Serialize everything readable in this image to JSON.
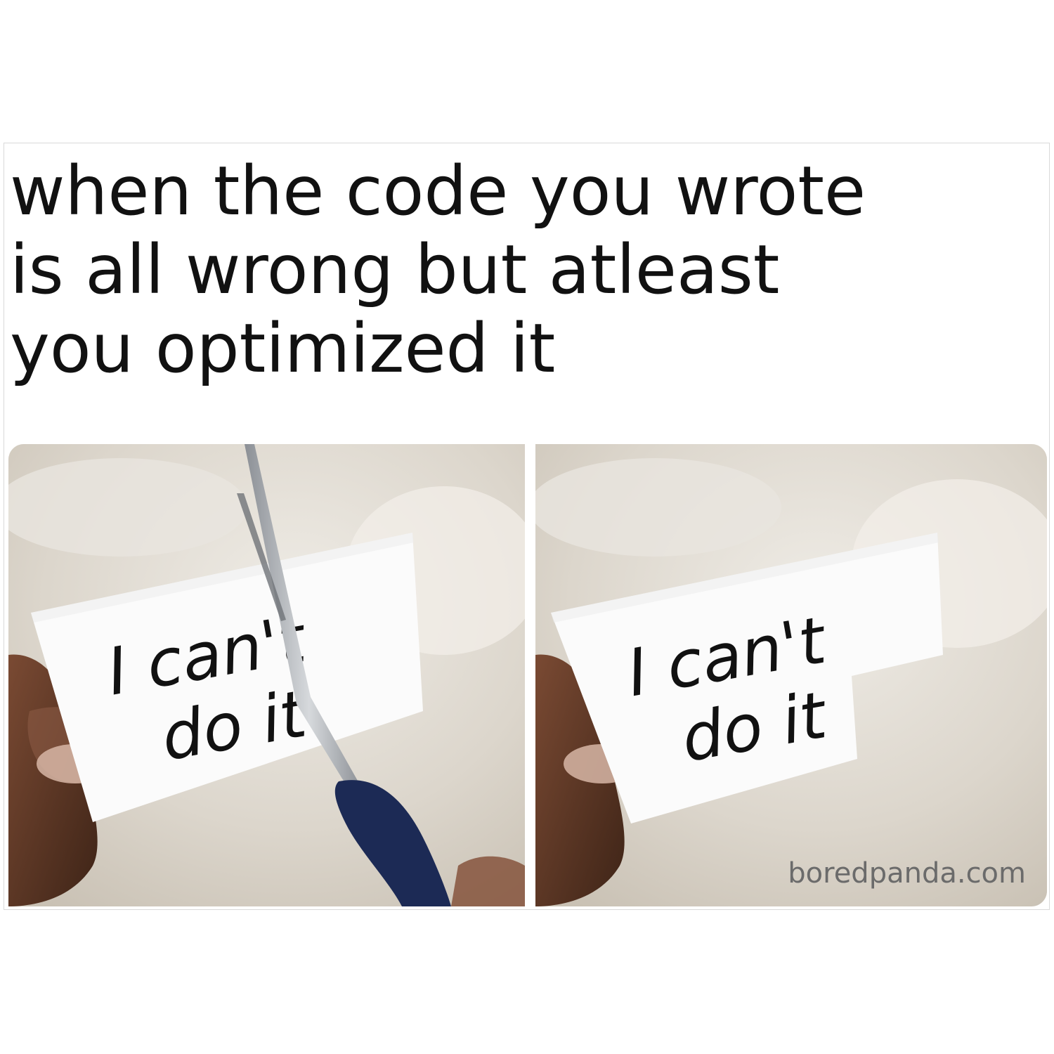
{
  "meme": {
    "caption_lines": [
      "when the code you wrote",
      "is all wrong but atleast",
      "you optimized it"
    ],
    "left_panel": {
      "note_line1": "I can't",
      "note_line2": "do it"
    },
    "right_panel": {
      "note_line1": "I can't",
      "note_line2": "do it"
    },
    "watermark": "boredpanda.com"
  },
  "colors": {
    "background": "#ffffff",
    "text": "#111111",
    "paper": "#fbfbfb",
    "scissor_handle": "#1c2a55",
    "watermark": "#6b6b6b"
  }
}
